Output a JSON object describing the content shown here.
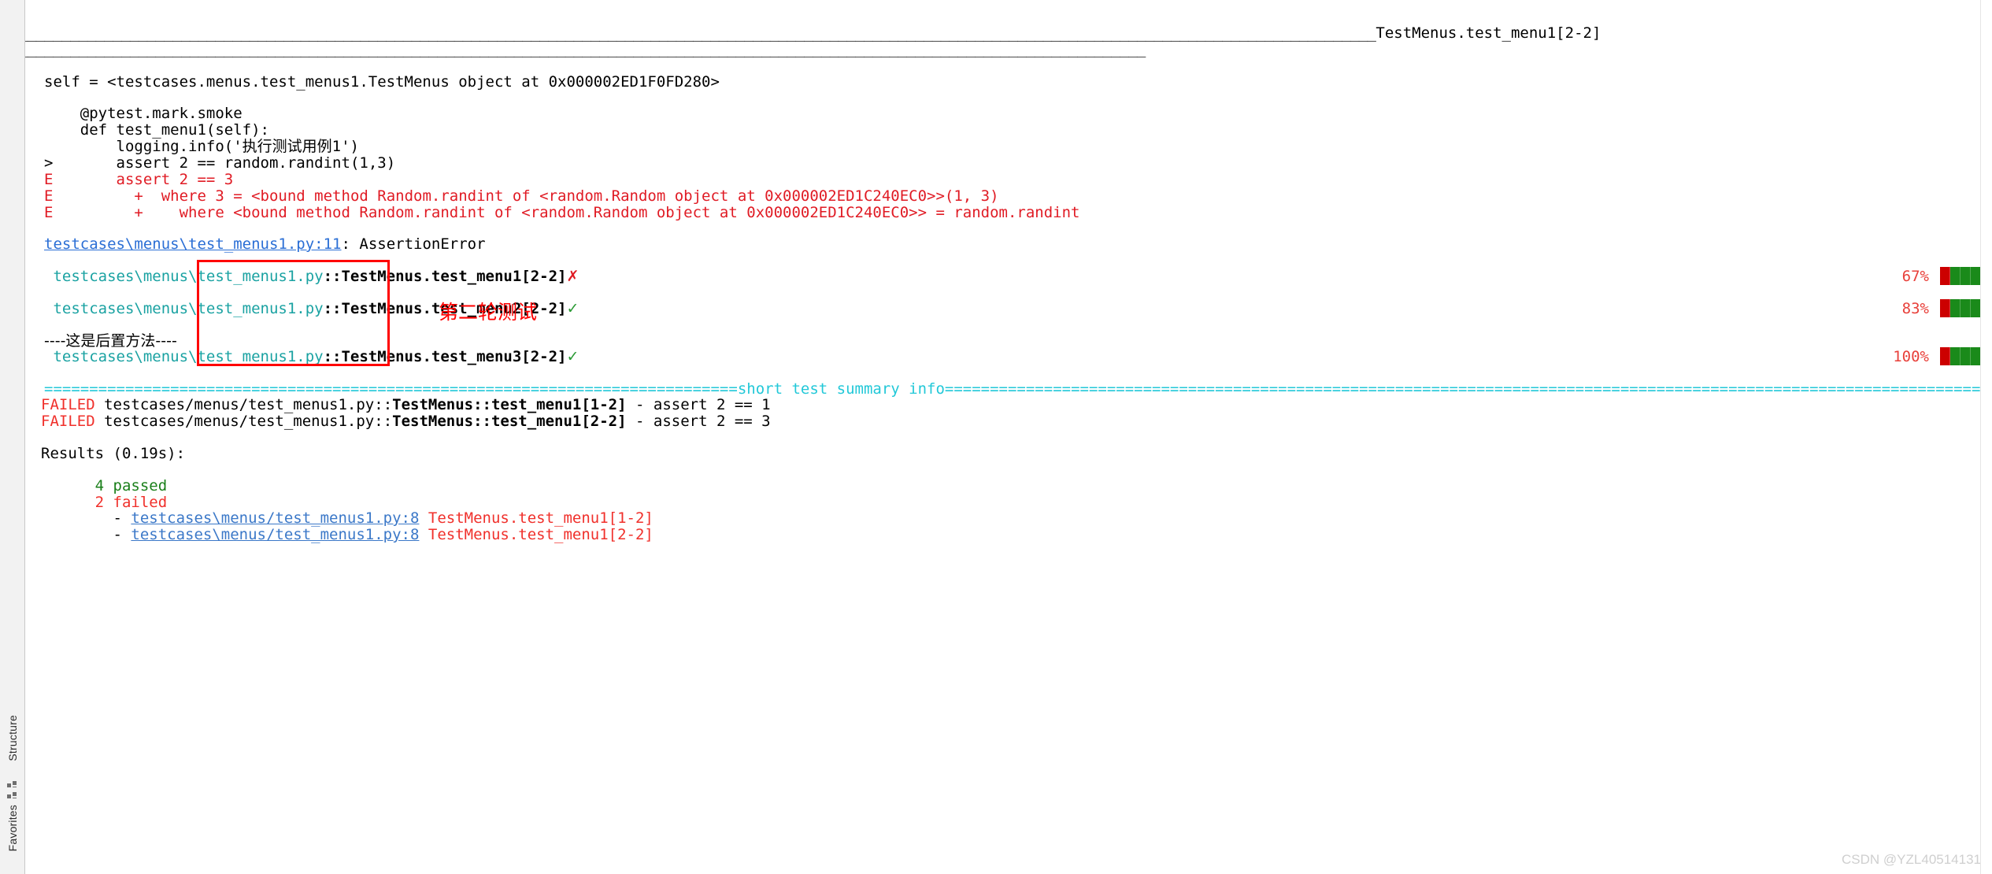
{
  "sidebar": {
    "structure_label": "Structure",
    "favorites_label": "Favorites",
    "structure_icon": "structure-icon",
    "favorites_icon": "favorites-icon"
  },
  "console": {
    "header": {
      "rule_left": "_______________________________________________________________________________________________________________________________________________________________",
      "title": "TestMenus.test_menu1[2-2]",
      "rule_under": "____________________________________________________________________________________________________________________________________"
    },
    "traceback": {
      "self_line": "self = <testcases.menus.test_menus1.TestMenus object at 0x000002ED1F0FD280>",
      "code_lines": [
        "    @pytest.mark.smoke",
        "    def test_menu1(self):",
        "        logging.info('执行测试用例1')"
      ],
      "assert_marker": ">",
      "assert_line": "       assert 2 == random.randint(1,3)",
      "error_lines": [
        {
          "marker": "E",
          "text": "       assert 2 == 3"
        },
        {
          "marker": "E",
          "text": "         +  where 3 = <bound method Random.randint of <random.Random object at 0x000002ED1C240EC0>>(1, 3)"
        },
        {
          "marker": "E",
          "text": "         +    where <bound method Random.randint of <random.Random object at 0x000002ED1C240EC0>> = random.randint"
        }
      ],
      "error_location_link": "testcases\\menus\\test_menus1.py:11",
      "error_location_suffix": ": AssertionError"
    },
    "test_results": [
      {
        "path": " testcases\\menus\\test_menus1.py",
        "node": "::TestMenus.test_menu1[2-2]",
        "status_icon": "✗",
        "status": "failed",
        "percent": "67%",
        "bar": [
          "red",
          "green",
          "green",
          "green",
          "green",
          "red",
          "red"
        ]
      },
      {
        "path": " testcases\\menus\\test_menus1.py",
        "node": "::TestMenus.test_menu2[2-2]",
        "status_icon": "✓",
        "status": "passed",
        "percent": "83%",
        "bar": [
          "red",
          "green",
          "green",
          "green",
          "green",
          "red",
          "green",
          "green",
          "green"
        ]
      },
      {
        "path": " testcases\\menus\\test_menus1.py",
        "node": "::TestMenus.test_menu3[2-2]",
        "status_icon": "✓",
        "status": "passed",
        "percent": "100%",
        "bar": [
          "red",
          "green",
          "green",
          "green",
          "green",
          "red",
          "green",
          "green",
          "green",
          "green"
        ]
      }
    ],
    "teardown_line": "----这是后置方法----",
    "summary_rule_left": "=============================================================================",
    "summary_title": "short test summary info",
    "summary_rule_right": "=============================================================================================================================================================================================================================================================================",
    "failed_lines": [
      {
        "keyword": "FAILED",
        "path": " testcases/menus/test_menus1.py::",
        "node": "TestMenus::test_menu1[1-2]",
        "detail": " - assert 2 == 1"
      },
      {
        "keyword": "FAILED",
        "path": " testcases/menus/test_menus1.py::",
        "node": "TestMenus::test_menu1[2-2]",
        "detail": " - assert 2 == 3"
      }
    ],
    "results": {
      "header": "Results (0.19s):",
      "passed_count": "      4 passed",
      "failed_count": "      2 failed",
      "failures": [
        {
          "dash": "        - ",
          "link": "testcases\\menus/test_menus1.py:8",
          "name": " TestMenus.test_menu1[1-2]"
        },
        {
          "dash": "        - ",
          "link": "testcases\\menus/test_menus1.py:8",
          "name": " TestMenus.test_menu1[2-2]"
        }
      ]
    }
  },
  "annotation": {
    "text": "第二轮测试",
    "color": "#ff0000"
  },
  "watermark": "CSDN @YZL40514131",
  "colors": {
    "error_red": "#e01b24",
    "pytest_red": "#f0302b",
    "teal": "#1aa2a2",
    "cyan": "#22c8d8",
    "green": "#2a9a34",
    "link_blue": "#2a6ed5",
    "bar_red": "#cc0000",
    "bar_green": "#1a8a1a"
  }
}
